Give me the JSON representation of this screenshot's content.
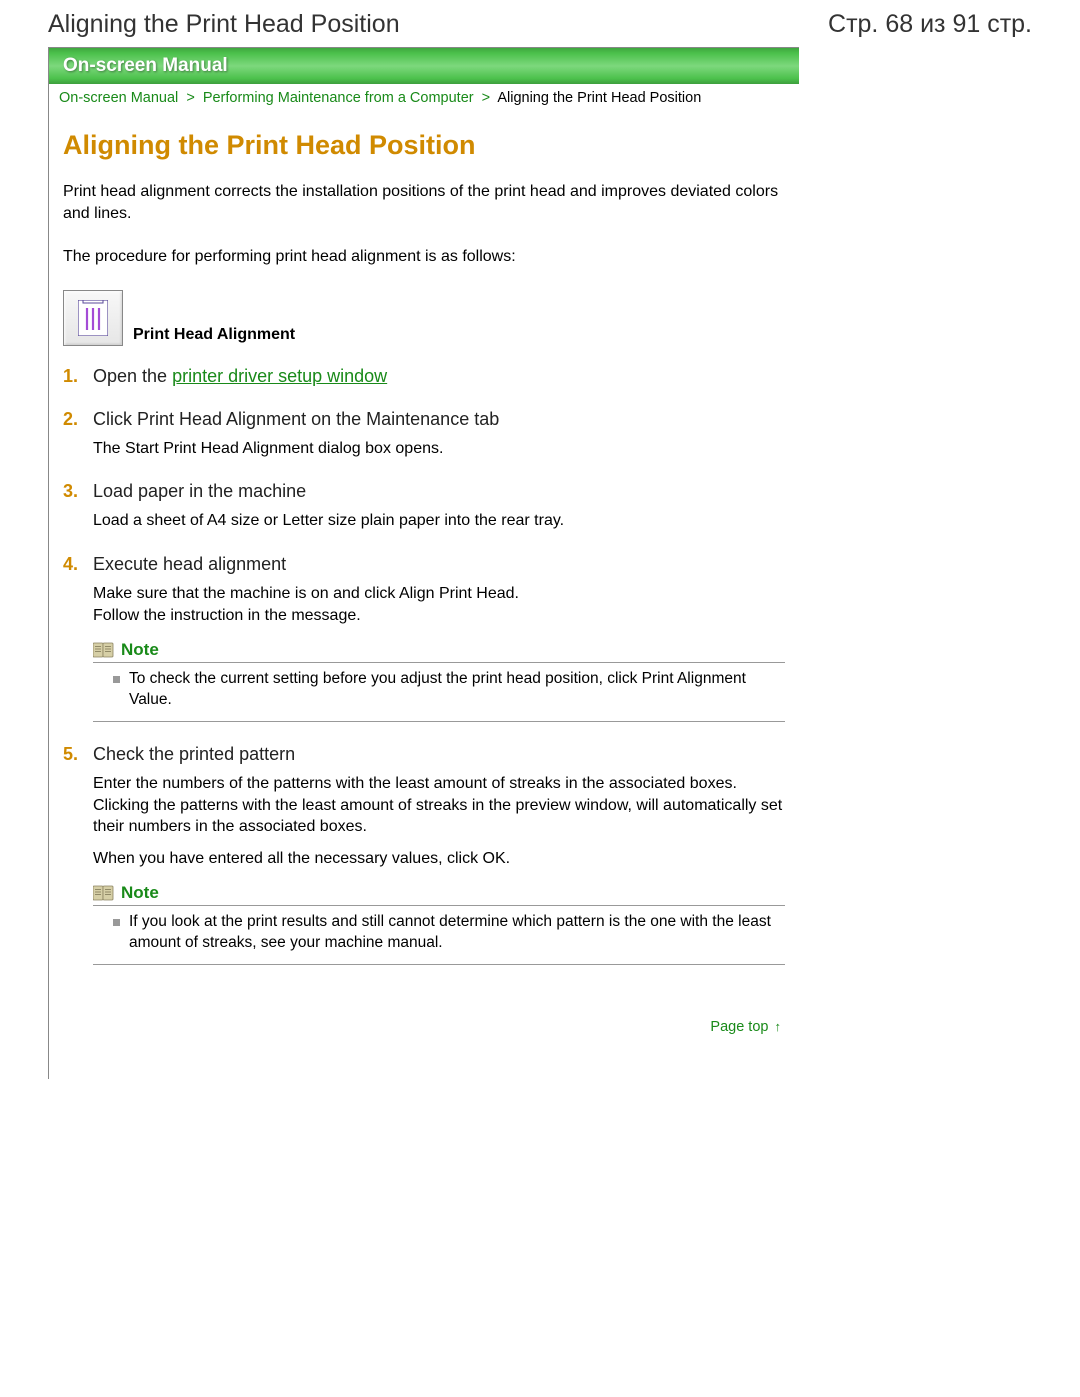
{
  "header": {
    "title": "Aligning the Print Head Position",
    "page_counter": "Стр. 68 из 91 стр."
  },
  "banner": {
    "label": "On-screen Manual"
  },
  "breadcrumb": {
    "items": [
      {
        "label": "On-screen Manual",
        "link": true
      },
      {
        "label": "Performing Maintenance from a Computer",
        "link": true
      },
      {
        "label": "Aligning the Print Head Position",
        "link": false
      }
    ],
    "sep": ">"
  },
  "main": {
    "heading": "Aligning the Print Head Position",
    "intro1": "Print head alignment corrects the installation positions of the print head and improves deviated colors and lines.",
    "intro2": "The procedure for performing print head alignment is as follows:",
    "icon_caption": "Print Head Alignment",
    "steps": [
      {
        "title_pre": "Open the ",
        "title_link": "printer driver setup window",
        "title_post": "",
        "body": [],
        "notes": []
      },
      {
        "title_pre": "Click Print Head Alignment on the Maintenance tab",
        "title_link": "",
        "title_post": "",
        "body": [
          "The Start Print Head Alignment dialog box opens."
        ],
        "notes": []
      },
      {
        "title_pre": "Load paper in the machine",
        "title_link": "",
        "title_post": "",
        "body": [
          "Load a sheet of A4 size or Letter size plain paper into the rear tray."
        ],
        "notes": []
      },
      {
        "title_pre": "Execute head alignment",
        "title_link": "",
        "title_post": "",
        "body": [
          "Make sure that the machine is on and click Align Print Head.",
          "Follow the instruction in the message."
        ],
        "notes": [
          {
            "label": "Note",
            "items": [
              "To check the current setting before you adjust the print head position, click Print Alignment Value."
            ]
          }
        ]
      },
      {
        "title_pre": "Check the printed pattern",
        "title_link": "",
        "title_post": "",
        "body": [
          "Enter the numbers of the patterns with the least amount of streaks in the associated boxes. Clicking the patterns with the least amount of streaks in the preview window, will automatically set their numbers in the associated boxes.",
          "When you have entered all the necessary values, click OK."
        ],
        "notes": [
          {
            "label": "Note",
            "items": [
              "If you look at the print results and still cannot determine which pattern is the one with the least amount of streaks, see your machine manual."
            ]
          }
        ]
      }
    ]
  },
  "page_top": {
    "label": "Page top"
  }
}
